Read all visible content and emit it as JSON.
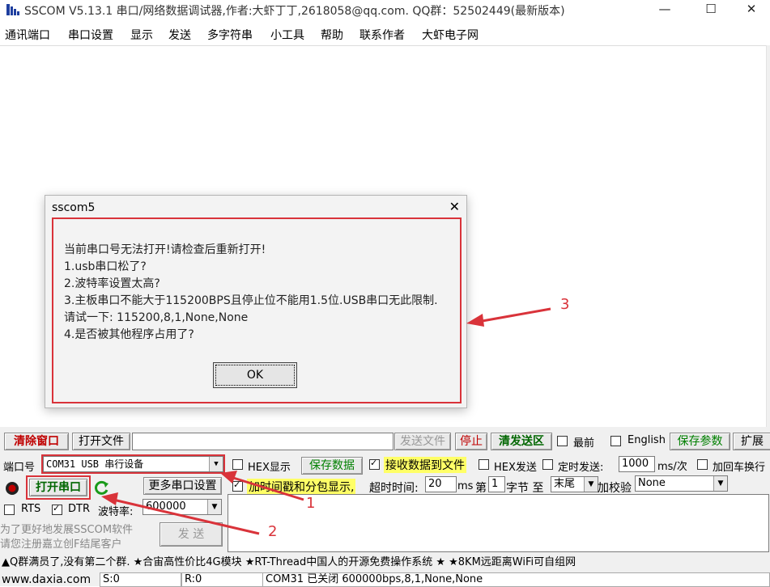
{
  "window": {
    "title": "SSCOM V5.13.1 串口/网络数据调试器,作者:大虾丁丁,2618058@qq.com. QQ群：52502449(最新版本)",
    "controls": [
      "—",
      "☐",
      "✕"
    ]
  },
  "menu": [
    "通讯端口",
    "串口设置",
    "显示",
    "发送",
    "多字符串",
    "小工具",
    "帮助",
    "联系作者",
    "大虾电子网"
  ],
  "dialog": {
    "title": "sscom5",
    "close": "✕",
    "lines": [
      "当前串口号无法打开!请检查后重新打开!",
      "1.usb串口松了?",
      "2.波特率设置太高?",
      "3.主板串口不能大于115200BPS且停止位不能用1.5位.USB串口无此限制.",
      "请试一下: 115200,8,1,None,None",
      "4.是否被其他程序占用了?"
    ],
    "ok": "OK"
  },
  "toolbar": {
    "clear_window": "清除窗口",
    "open_file": "打开文件",
    "send_file": "发送文件",
    "stop": "停止",
    "clear_send": "清发送区",
    "last": "最前",
    "english": "English",
    "save_params": "保存参数",
    "expand": "扩展"
  },
  "port": {
    "label": "端口号",
    "value": "COM31 USB 串行设备",
    "open_btn": "打开串口",
    "more_settings": "更多串口设置",
    "rts": "RTS",
    "dtr": "DTR",
    "baud_label": "波特率:",
    "baud_value": "600000"
  },
  "options": {
    "hex_display": "HEX显示",
    "save_data": "保存数据",
    "recv_to_file": "接收数据到文件",
    "hex_send": "HEX发送",
    "timed_send": "定时发送:",
    "interval": "1000",
    "unit": "ms/次",
    "add_crlf": "加回车换行",
    "timestamp": "加时间戳和分包显示,",
    "timeout_label": "超时时间:",
    "timeout_value": "20",
    "ms": "ms",
    "byte_prefix": "第",
    "byte_num": "1",
    "byte_suffix": "字节 至",
    "end": "末尾",
    "checksum": "加校验",
    "checksum_value": "None"
  },
  "promo": [
    "为了更好地发展SSCOM软件",
    "请您注册嘉立创F结尾客户"
  ],
  "send_button": "发 送",
  "ticker": "▲Q群满员了,没有第二个群. ★合宙高性价比4G模块 ★RT-Thread中国人的开源免费操作系统 ★ ★8KM远距离WiFi可自组网",
  "status": {
    "site": "www.daxia.com",
    "s": "S:0",
    "r": "R:0",
    "info": "COM31 已关闭  600000bps,8,1,None,None"
  },
  "annotations": [
    "1",
    "2",
    "3"
  ],
  "colors": {
    "highlight": "#d9333a",
    "button_text_red": "#c00000",
    "button_text_green": "#008000",
    "yellow": "#ffff66"
  }
}
